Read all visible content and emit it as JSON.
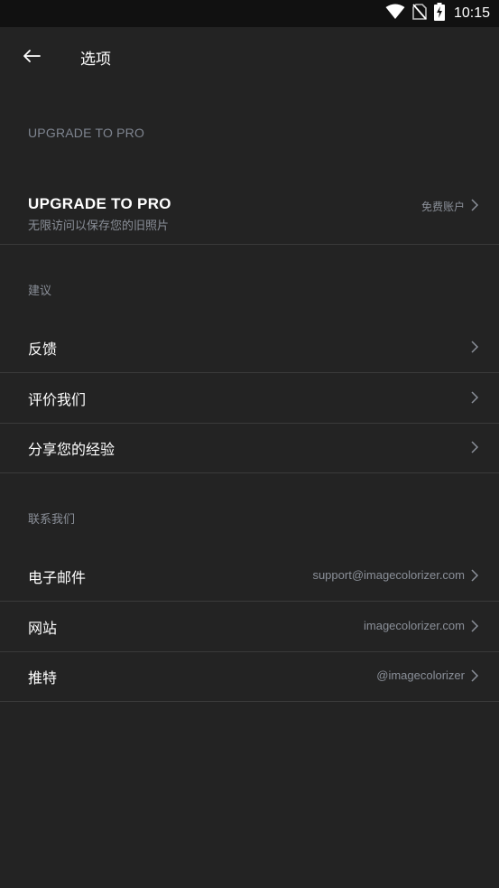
{
  "status_bar": {
    "time": "10:15",
    "icons": [
      "wifi-icon",
      "no-sim-icon",
      "battery-charging-icon"
    ]
  },
  "app_bar": {
    "back_icon": "arrow-left-icon",
    "title": "选项"
  },
  "sections": {
    "upgrade": {
      "header": "UPGRADE TO PRO",
      "item": {
        "title": "UPGRADE TO PRO",
        "subtitle": "无限访问以保存您的旧照片",
        "value": "免费账户"
      }
    },
    "suggestions": {
      "header": "建议",
      "items": [
        {
          "label": "反馈"
        },
        {
          "label": "评价我们"
        },
        {
          "label": "分享您的经验"
        }
      ]
    },
    "contact": {
      "header": "联系我们",
      "items": [
        {
          "label": "电子邮件",
          "value": "support@imagecolorizer.com"
        },
        {
          "label": "网站",
          "value": "imagecolorizer.com"
        },
        {
          "label": "推特",
          "value": "@imagecolorizer"
        }
      ]
    }
  },
  "colors": {
    "background": "#232323",
    "status_bar": "#111111",
    "divider": "#3a3a3a",
    "secondary_text": "#8a8f98"
  }
}
